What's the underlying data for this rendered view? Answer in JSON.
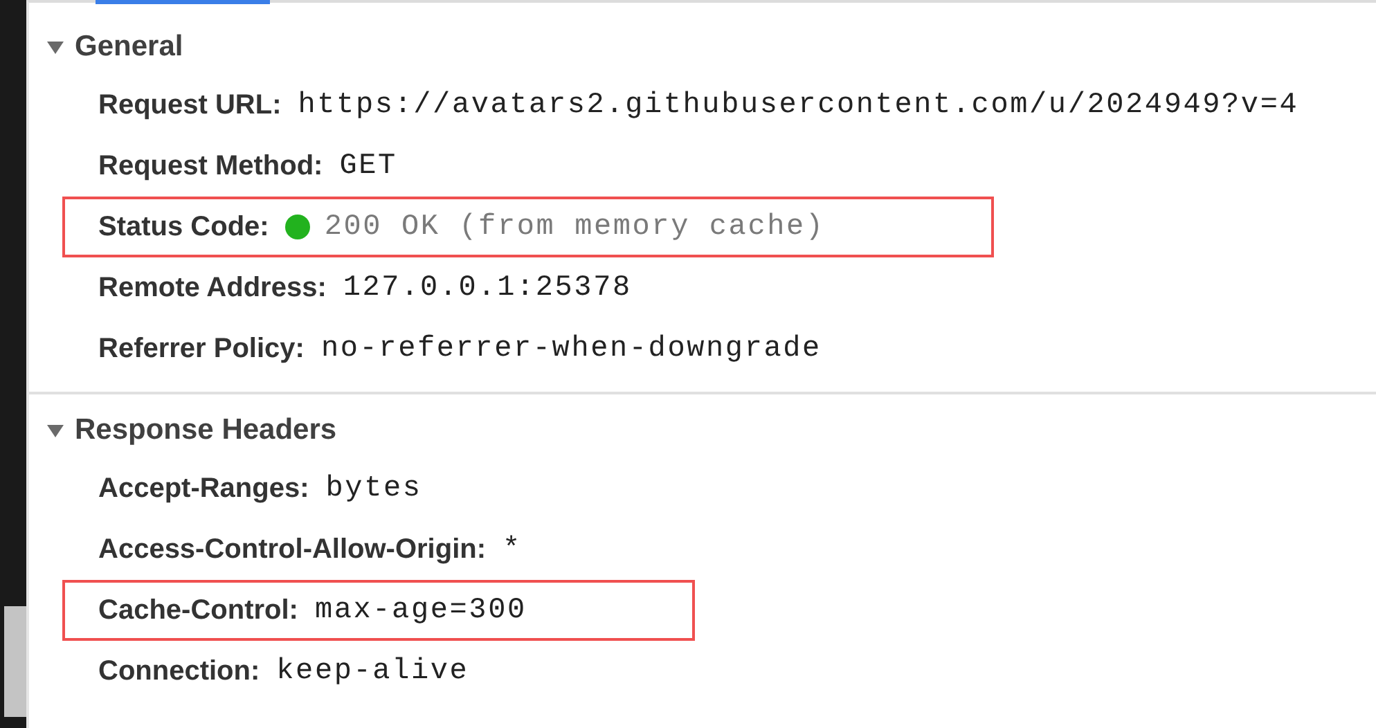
{
  "sections": [
    {
      "title": "General",
      "expanded": true,
      "rows": [
        {
          "label": "Request URL:",
          "value": "https://avatars2.githubusercontent.com/u/2024949?v=4",
          "highlighted": false
        },
        {
          "label": "Request Method:",
          "value": "GET",
          "highlighted": false
        },
        {
          "label": "Status Code:",
          "value": "200 OK (from memory cache)",
          "kind": "status",
          "color": "#22b21e",
          "highlighted": true
        },
        {
          "label": "Remote Address:",
          "value": "127.0.0.1:25378",
          "highlighted": false
        },
        {
          "label": "Referrer Policy:",
          "value": "no-referrer-when-downgrade",
          "highlighted": false
        }
      ]
    },
    {
      "title": "Response Headers",
      "expanded": true,
      "rows": [
        {
          "label": "Accept-Ranges:",
          "value": "bytes",
          "highlighted": false
        },
        {
          "label": "Access-Control-Allow-Origin:",
          "value": "*",
          "highlighted": false
        },
        {
          "label": "Cache-Control:",
          "value": "max-age=300",
          "highlighted": true
        },
        {
          "label": "Connection:",
          "value": "keep-alive",
          "highlighted": false
        }
      ]
    }
  ]
}
